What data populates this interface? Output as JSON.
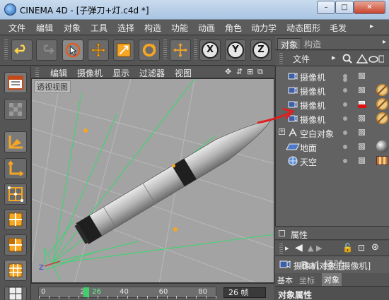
{
  "window": {
    "title": "CINEMA 4D - [子弹刀+灯.c4d *]",
    "min": "–",
    "max": "□",
    "close": "✕"
  },
  "menu": [
    "文件",
    "编辑",
    "对象",
    "工具",
    "选择",
    "构造",
    "功能",
    "动画",
    "角色",
    "动力学",
    "动态图形",
    "毛发"
  ],
  "menu_more": "▸",
  "toolbar": {
    "x_label": "X",
    "y_label": "Y",
    "z_label": "Z"
  },
  "viewport": {
    "menu": [
      "编辑",
      "摄像机",
      "显示",
      "过滤器",
      "视图"
    ],
    "label": "透视视图",
    "controls": [
      "✥",
      "⇵",
      "⊞",
      "⧉"
    ]
  },
  "timeline": {
    "ticks": [
      {
        "label": "0",
        "frame": 0
      },
      {
        "label": "20",
        "frame": 20
      },
      {
        "label": "26",
        "frame": 26
      },
      {
        "label": "40",
        "frame": 40
      },
      {
        "label": "60",
        "frame": 60
      },
      {
        "label": "80",
        "frame": 80
      }
    ],
    "current_frame": 26,
    "end_field": "26 帧"
  },
  "object_manager": {
    "tabs": [
      "对象",
      "构造"
    ],
    "toolbar_label": "文件",
    "objects": [
      {
        "name": "摄像机",
        "icon": "camera-icon",
        "tag": "none"
      },
      {
        "name": "摄像机",
        "icon": "camera-icon",
        "tag": "protection"
      },
      {
        "name": "摄像机",
        "icon": "camera-icon",
        "tag": "protection"
      },
      {
        "name": "摄像机",
        "icon": "camera-icon",
        "tag": "protection"
      },
      {
        "name": "空白对象",
        "icon": "null-icon",
        "tag": "none"
      },
      {
        "name": "地面",
        "icon": "floor-icon",
        "tag": "material"
      },
      {
        "name": "天空",
        "icon": "sky-icon",
        "tag": "texture"
      }
    ]
  },
  "attributes": {
    "header": "属性",
    "title": "摄像机对象 [摄像机]",
    "tabs": [
      "基本",
      "坐标",
      "对象"
    ],
    "section": "对象属性"
  },
  "watermark": "Bai 经验"
}
